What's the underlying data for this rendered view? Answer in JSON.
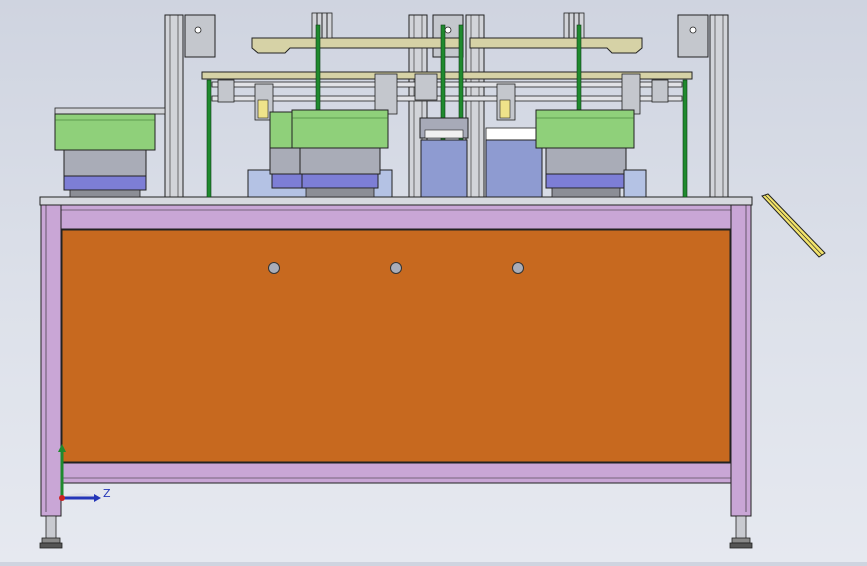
{
  "viewport": {
    "background_top": "#cfd4e0",
    "background_bottom": "#e6e9f0"
  },
  "model": {
    "frame_color": "#c9a6d6",
    "panel_color": "#c7691f",
    "bowl_green": "#8fd07a",
    "bowl_grey": "#a9acb7",
    "bowl_blue": "#7d7ed6",
    "rod_green": "#1f8a2e",
    "beam_tan": "#d6d2a6",
    "column_grey": "#d2d4d9"
  },
  "triad": {
    "axis_label": "Z"
  }
}
